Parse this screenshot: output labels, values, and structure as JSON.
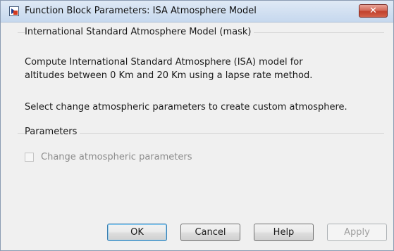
{
  "window": {
    "title": "Function Block Parameters: ISA Atmosphere Model",
    "close_glyph": "✕",
    "icon": "simulink-block-icon"
  },
  "description_group": {
    "title": "International Standard Atmosphere Model (mask)",
    "line1": "Compute International Standard Atmosphere (ISA) model for",
    "line2": "altitudes between 0 Km and 20 Km using a lapse rate method.",
    "line3": "Select change atmospheric parameters to create custom atmosphere."
  },
  "parameters_group": {
    "title": "Parameters",
    "checkbox_label": "Change atmospheric parameters",
    "checkbox_checked": false
  },
  "buttons": {
    "ok": "OK",
    "cancel": "Cancel",
    "help": "Help",
    "apply": "Apply"
  }
}
